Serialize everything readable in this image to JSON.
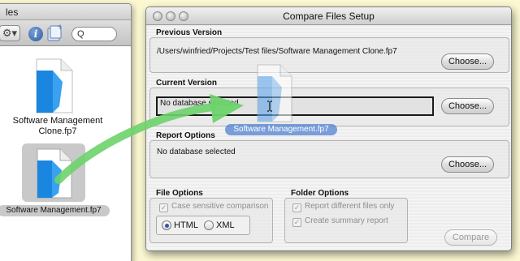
{
  "finder": {
    "title_partial": "les",
    "search_glyph": "Q",
    "files": [
      {
        "name": "Software Management Clone.fp7"
      },
      {
        "name": "Software Management.fp7"
      }
    ]
  },
  "dialog": {
    "title": "Compare Files Setup",
    "previous_version": {
      "heading": "Previous Version",
      "path": "/Users/winfried/Projects/Test files/Software Management Clone.fp7",
      "button": "Choose..."
    },
    "current_version": {
      "heading": "Current Version",
      "value": "No database selected",
      "button": "Choose..."
    },
    "report_options": {
      "heading": "Report Options",
      "value": "No database selected",
      "button": "Choose..."
    },
    "file_options": {
      "heading": "File Options",
      "case_sensitive": {
        "label": "Case sensitive comparison",
        "checked": true,
        "enabled": false
      },
      "format": {
        "selected": "HTML",
        "options": [
          "HTML",
          "XML"
        ]
      }
    },
    "folder_options": {
      "heading": "Folder Options",
      "report_different": {
        "label": "Report different files only",
        "checked": true,
        "enabled": false
      },
      "summary_report": {
        "label": "Create summary report",
        "checked": true,
        "enabled": false
      }
    },
    "compare_button": "Compare"
  },
  "drag": {
    "label": "Software Management.fp7"
  },
  "colors": {
    "background": "#fbf8d2",
    "drag_arrow": "#6dd36a",
    "doc_blue": "#1a86e0",
    "drag_label_bg": "#5082d2"
  }
}
